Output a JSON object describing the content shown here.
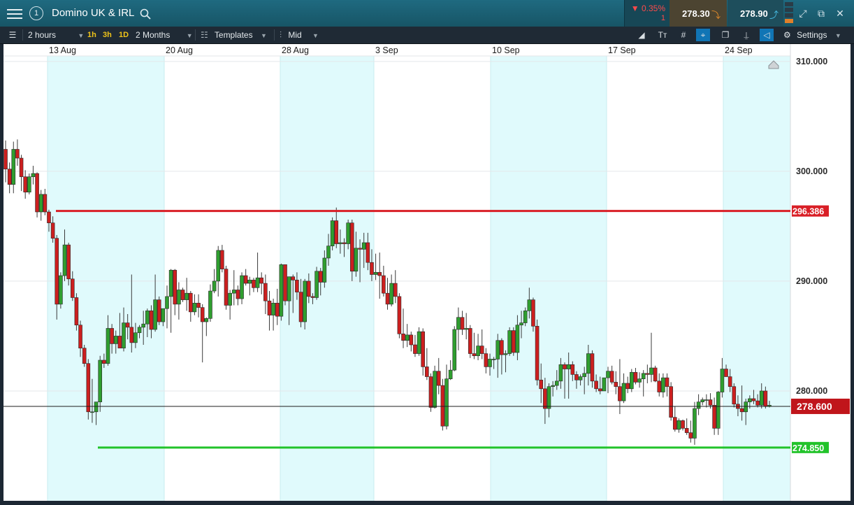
{
  "header": {
    "title": "Domino UK & IRL",
    "change_pct": "▼ 0.35%",
    "change_count": "1",
    "sell_price": "278.30",
    "buy_price": "278.90"
  },
  "toolbar": {
    "interval": "2 hours",
    "quick_intervals": [
      "1h",
      "3h",
      "1D"
    ],
    "range": "2 Months",
    "templates": "Templates",
    "price_mode": "Mid",
    "settings": "Settings"
  },
  "colors": {
    "up": "#2f9e2f",
    "down": "#cc1f1f",
    "resistance": "#d91f26",
    "support": "#22c32a",
    "last_price": "#c0151b",
    "week_shade": "#e0fafc"
  },
  "chart_data": {
    "type": "candlestick",
    "x_labels": [
      "13 Aug",
      "20 Aug",
      "28 Aug",
      "3 Sep",
      "10 Sep",
      "17 Sep",
      "24 Sep"
    ],
    "y_ticks": [
      "310.000",
      "300.000",
      "290.000",
      "280.000"
    ],
    "ylim": [
      270,
      310.5
    ],
    "resistance": {
      "value": 296.386,
      "label": "296.386"
    },
    "support": {
      "value": 274.85,
      "label": "274.850"
    },
    "last_price": {
      "value": 278.6,
      "label": "278.600"
    },
    "candles": [
      [
        302.0,
        302.8,
        299.0,
        300.2
      ],
      [
        300.2,
        300.8,
        298.0,
        298.8
      ],
      [
        298.8,
        302.7,
        298.0,
        302.0
      ],
      [
        302.0,
        302.9,
        300.5,
        301.2
      ],
      [
        301.2,
        301.5,
        298.2,
        299.5
      ],
      [
        299.5,
        300.1,
        297.5,
        298.1
      ],
      [
        298.1,
        299.8,
        297.9,
        299.5
      ],
      [
        299.5,
        300.5,
        298.8,
        299.8
      ],
      [
        299.8,
        299.9,
        295.8,
        296.3
      ],
      [
        296.3,
        298.3,
        295.5,
        297.9
      ],
      [
        297.9,
        298.4,
        296.0,
        296.3
      ],
      [
        296.3,
        296.5,
        294.5,
        295.3
      ],
      [
        295.3,
        295.9,
        293.5,
        293.9
      ],
      [
        293.9,
        294.2,
        286.5,
        287.9
      ],
      [
        287.9,
        290.8,
        287.5,
        290.5
      ],
      [
        290.5,
        294.7,
        290.0,
        293.3
      ],
      [
        293.3,
        293.5,
        289.6,
        290.2
      ],
      [
        290.2,
        290.9,
        288.2,
        288.5
      ],
      [
        288.5,
        288.9,
        285.5,
        286.0
      ],
      [
        286.0,
        286.4,
        283.1,
        283.9
      ],
      [
        283.9,
        284.2,
        282.2,
        282.5
      ],
      [
        282.5,
        282.9,
        277.4,
        278.1
      ],
      [
        278.1,
        281.1,
        277.1,
        278.1
      ],
      [
        278.1,
        279.0,
        276.9,
        279.0
      ],
      [
        279.0,
        283.2,
        278.1,
        282.8
      ],
      [
        282.8,
        283.4,
        282.1,
        282.5
      ],
      [
        282.5,
        286.9,
        282.3,
        285.7
      ],
      [
        285.7,
        286.1,
        283.4,
        284.3
      ],
      [
        284.3,
        285.5,
        283.4,
        285.0
      ],
      [
        285.0,
        287.1,
        283.9,
        283.9
      ],
      [
        283.9,
        287.6,
        283.6,
        286.2
      ],
      [
        286.2,
        287.0,
        284.7,
        285.8
      ],
      [
        285.8,
        290.6,
        283.5,
        284.4
      ],
      [
        284.4,
        286.2,
        283.9,
        285.3
      ],
      [
        285.3,
        286.0,
        284.8,
        285.8
      ],
      [
        285.8,
        287.3,
        284.2,
        286.1
      ],
      [
        286.1,
        287.5,
        284.9,
        287.3
      ],
      [
        287.3,
        287.8,
        284.8,
        285.6
      ],
      [
        285.6,
        290.6,
        285.4,
        288.3
      ],
      [
        288.3,
        288.6,
        286.0,
        286.3
      ],
      [
        286.3,
        287.5,
        285.9,
        287.5
      ],
      [
        287.5,
        289.6,
        285.7,
        288.6
      ],
      [
        288.6,
        291.1,
        285.3,
        291.0
      ],
      [
        291.0,
        291.1,
        286.9,
        287.9
      ],
      [
        287.9,
        289.9,
        286.5,
        289.2
      ],
      [
        289.2,
        289.4,
        288.1,
        288.3
      ],
      [
        288.3,
        290.3,
        287.3,
        288.9
      ],
      [
        288.9,
        289.1,
        286.3,
        287.2
      ],
      [
        287.2,
        288.8,
        286.9,
        288.0
      ],
      [
        288.0,
        288.8,
        286.7,
        287.6
      ],
      [
        287.6,
        287.9,
        282.6,
        286.3
      ],
      [
        286.3,
        286.7,
        285.0,
        286.6
      ],
      [
        286.6,
        289.7,
        286.3,
        289.1
      ],
      [
        289.1,
        291.1,
        288.9,
        290.0
      ],
      [
        290.0,
        293.2,
        288.6,
        292.8
      ],
      [
        292.8,
        293.3,
        290.8,
        291.1
      ],
      [
        291.1,
        291.4,
        287.4,
        287.8
      ],
      [
        287.8,
        289.2,
        286.5,
        288.9
      ],
      [
        288.9,
        291.0,
        287.8,
        289.2
      ],
      [
        289.2,
        289.6,
        287.8,
        288.4
      ],
      [
        288.4,
        290.8,
        287.9,
        290.5
      ],
      [
        290.5,
        291.1,
        289.6,
        289.8
      ],
      [
        289.8,
        290.4,
        288.7,
        290.1
      ],
      [
        290.1,
        290.3,
        289.0,
        289.4
      ],
      [
        289.4,
        292.6,
        289.0,
        290.3
      ],
      [
        290.3,
        290.8,
        288.8,
        289.8
      ],
      [
        289.8,
        290.6,
        287.0,
        288.2
      ],
      [
        288.2,
        289.1,
        285.5,
        286.9
      ],
      [
        286.9,
        288.4,
        285.5,
        288.0
      ],
      [
        288.0,
        289.3,
        286.0,
        286.8
      ],
      [
        286.8,
        291.6,
        286.4,
        291.5
      ],
      [
        291.5,
        291.5,
        287.8,
        288.2
      ],
      [
        288.2,
        289.7,
        286.0,
        290.4
      ],
      [
        290.4,
        290.6,
        287.1,
        290.1
      ],
      [
        290.1,
        290.8,
        288.3,
        289.0
      ],
      [
        289.0,
        290.2,
        285.8,
        286.3
      ],
      [
        286.3,
        290.2,
        285.6,
        290.0
      ],
      [
        290.0,
        290.7,
        288.0,
        288.6
      ],
      [
        288.6,
        288.9,
        287.9,
        288.5
      ],
      [
        288.5,
        291.3,
        288.3,
        290.9
      ],
      [
        290.9,
        291.2,
        288.7,
        289.9
      ],
      [
        289.9,
        292.8,
        289.4,
        292.1
      ],
      [
        292.1,
        294.3,
        291.4,
        293.2
      ],
      [
        293.2,
        295.8,
        292.8,
        295.5
      ],
      [
        295.5,
        296.7,
        293.0,
        293.4
      ],
      [
        293.4,
        294.7,
        292.5,
        293.5
      ],
      [
        293.5,
        293.9,
        292.2,
        293.4
      ],
      [
        293.4,
        295.6,
        292.9,
        295.3
      ],
      [
        295.3,
        295.6,
        290.0,
        290.9
      ],
      [
        290.9,
        294.5,
        290.4,
        293.0
      ],
      [
        293.0,
        293.8,
        289.9,
        292.9
      ],
      [
        292.9,
        294.4,
        291.2,
        293.5
      ],
      [
        293.5,
        294.4,
        291.0,
        291.7
      ],
      [
        291.7,
        292.9,
        290.0,
        290.6
      ],
      [
        290.6,
        292.5,
        290.1,
        290.8
      ],
      [
        290.8,
        292.6,
        288.4,
        290.5
      ],
      [
        290.5,
        291.4,
        288.6,
        288.9
      ],
      [
        288.9,
        290.3,
        287.4,
        287.9
      ],
      [
        287.9,
        290.6,
        287.7,
        289.8
      ],
      [
        289.8,
        291.0,
        288.0,
        288.6
      ],
      [
        288.6,
        288.9,
        284.8,
        285.2
      ],
      [
        285.2,
        287.5,
        283.9,
        284.6
      ],
      [
        284.6,
        286.1,
        284.0,
        285.1
      ],
      [
        285.1,
        285.4,
        283.6,
        284.2
      ],
      [
        284.2,
        285.1,
        283.1,
        283.4
      ],
      [
        283.4,
        285.8,
        283.2,
        285.4
      ],
      [
        285.4,
        285.7,
        281.4,
        282.2
      ],
      [
        282.2,
        283.9,
        281.0,
        281.3
      ],
      [
        281.3,
        281.6,
        278.1,
        278.5
      ],
      [
        278.5,
        282.3,
        278.4,
        281.8
      ],
      [
        281.8,
        283.0,
        279.7,
        280.5
      ],
      [
        280.5,
        281.1,
        276.4,
        276.8
      ],
      [
        276.8,
        282.4,
        276.5,
        281.1
      ],
      [
        281.1,
        282.8,
        281.0,
        281.9
      ],
      [
        281.9,
        285.9,
        281.8,
        285.6
      ],
      [
        285.6,
        287.6,
        283.7,
        286.7
      ],
      [
        286.7,
        287.3,
        285.1,
        285.6
      ],
      [
        285.6,
        287.1,
        284.7,
        285.7
      ],
      [
        285.7,
        286.0,
        283.0,
        283.4
      ],
      [
        283.4,
        285.3,
        282.9,
        283.2
      ],
      [
        283.2,
        285.2,
        282.8,
        284.1
      ],
      [
        284.1,
        285.6,
        282.9,
        283.4
      ],
      [
        283.4,
        283.9,
        281.6,
        282.2
      ],
      [
        282.2,
        283.4,
        281.4,
        282.9
      ],
      [
        282.9,
        283.1,
        282.0,
        282.9
      ],
      [
        282.9,
        285.2,
        281.2,
        284.6
      ],
      [
        284.6,
        284.8,
        281.5,
        283.3
      ],
      [
        283.3,
        283.7,
        281.7,
        283.4
      ],
      [
        283.4,
        285.8,
        283.2,
        285.5
      ],
      [
        285.5,
        285.8,
        283.2,
        283.5
      ],
      [
        283.5,
        286.9,
        282.8,
        286.0
      ],
      [
        286.0,
        287.3,
        284.8,
        286.2
      ],
      [
        286.2,
        287.6,
        285.9,
        287.3
      ],
      [
        287.3,
        289.4,
        286.6,
        288.3
      ],
      [
        288.3,
        288.5,
        285.4,
        285.9
      ],
      [
        285.9,
        286.5,
        280.5,
        281.0
      ],
      [
        281.0,
        282.5,
        278.9,
        280.2
      ],
      [
        280.2,
        281.2,
        277.0,
        278.4
      ],
      [
        278.4,
        280.7,
        277.6,
        280.4
      ],
      [
        280.4,
        280.9,
        279.5,
        280.5
      ],
      [
        280.5,
        281.9,
        280.1,
        280.9
      ],
      [
        280.9,
        283.0,
        280.2,
        282.4
      ],
      [
        282.4,
        282.6,
        279.3,
        282.0
      ],
      [
        282.0,
        283.5,
        279.3,
        282.4
      ],
      [
        282.4,
        282.7,
        280.9,
        281.5
      ],
      [
        281.5,
        281.8,
        280.2,
        281.0
      ],
      [
        281.0,
        281.5,
        280.5,
        281.3
      ],
      [
        281.3,
        282.2,
        279.7,
        281.6
      ],
      [
        281.6,
        284.2,
        280.5,
        283.4
      ],
      [
        283.4,
        283.7,
        280.3,
        280.9
      ],
      [
        280.9,
        281.5,
        279.9,
        280.2
      ],
      [
        280.2,
        281.3,
        279.7,
        280.0
      ],
      [
        280.0,
        281.2,
        280.0,
        281.2
      ],
      [
        281.2,
        282.2,
        279.8,
        281.8
      ],
      [
        281.8,
        282.3,
        280.6,
        280.8
      ],
      [
        280.8,
        281.8,
        279.7,
        280.4
      ],
      [
        280.4,
        282.9,
        277.9,
        279.1
      ],
      [
        279.1,
        281.6,
        278.9,
        280.7
      ],
      [
        280.7,
        281.3,
        279.8,
        280.2
      ],
      [
        280.2,
        282.0,
        279.9,
        281.7
      ],
      [
        281.7,
        282.1,
        280.6,
        280.8
      ],
      [
        280.8,
        281.7,
        280.3,
        281.1
      ],
      [
        281.1,
        281.9,
        279.5,
        281.6
      ],
      [
        281.6,
        282.4,
        280.7,
        281.5
      ],
      [
        281.5,
        285.3,
        280.8,
        282.1
      ],
      [
        282.1,
        282.3,
        280.8,
        280.9
      ],
      [
        280.9,
        281.6,
        279.5,
        279.9
      ],
      [
        279.9,
        281.6,
        279.4,
        281.2
      ],
      [
        281.2,
        281.6,
        279.5,
        280.4
      ],
      [
        280.4,
        280.8,
        277.3,
        277.6
      ],
      [
        277.6,
        278.6,
        276.3,
        276.5
      ],
      [
        276.5,
        277.5,
        276.2,
        277.3
      ],
      [
        277.3,
        277.4,
        276.4,
        276.6
      ],
      [
        276.6,
        277.5,
        276.0,
        276.2
      ],
      [
        276.2,
        277.3,
        275.3,
        275.7
      ],
      [
        275.7,
        279.0,
        275.1,
        278.4
      ],
      [
        278.4,
        279.7,
        277.8,
        279.0
      ],
      [
        279.0,
        279.4,
        278.7,
        279.2
      ],
      [
        279.2,
        279.7,
        278.5,
        279.2
      ],
      [
        279.2,
        279.8,
        278.4,
        278.7
      ],
      [
        278.7,
        279.4,
        276.0,
        276.6
      ],
      [
        276.6,
        280.0,
        276.0,
        279.9
      ],
      [
        279.9,
        283.0,
        279.4,
        282.0
      ],
      [
        282.0,
        282.4,
        281.3,
        281.3
      ],
      [
        281.3,
        282.0,
        279.9,
        280.4
      ],
      [
        280.4,
        280.7,
        278.5,
        278.8
      ],
      [
        278.8,
        279.6,
        277.7,
        278.4
      ],
      [
        278.4,
        280.5,
        277.3,
        278.1
      ],
      [
        278.1,
        279.3,
        276.9,
        279.0
      ],
      [
        279.0,
        279.6,
        278.4,
        279.3
      ],
      [
        279.3,
        280.1,
        278.8,
        279.1
      ],
      [
        279.1,
        279.7,
        278.5,
        278.7
      ],
      [
        278.7,
        280.7,
        278.4,
        280.0
      ],
      [
        280.0,
        280.4,
        278.4,
        278.6
      ],
      [
        278.6,
        279.1,
        278.5,
        278.7
      ]
    ]
  }
}
